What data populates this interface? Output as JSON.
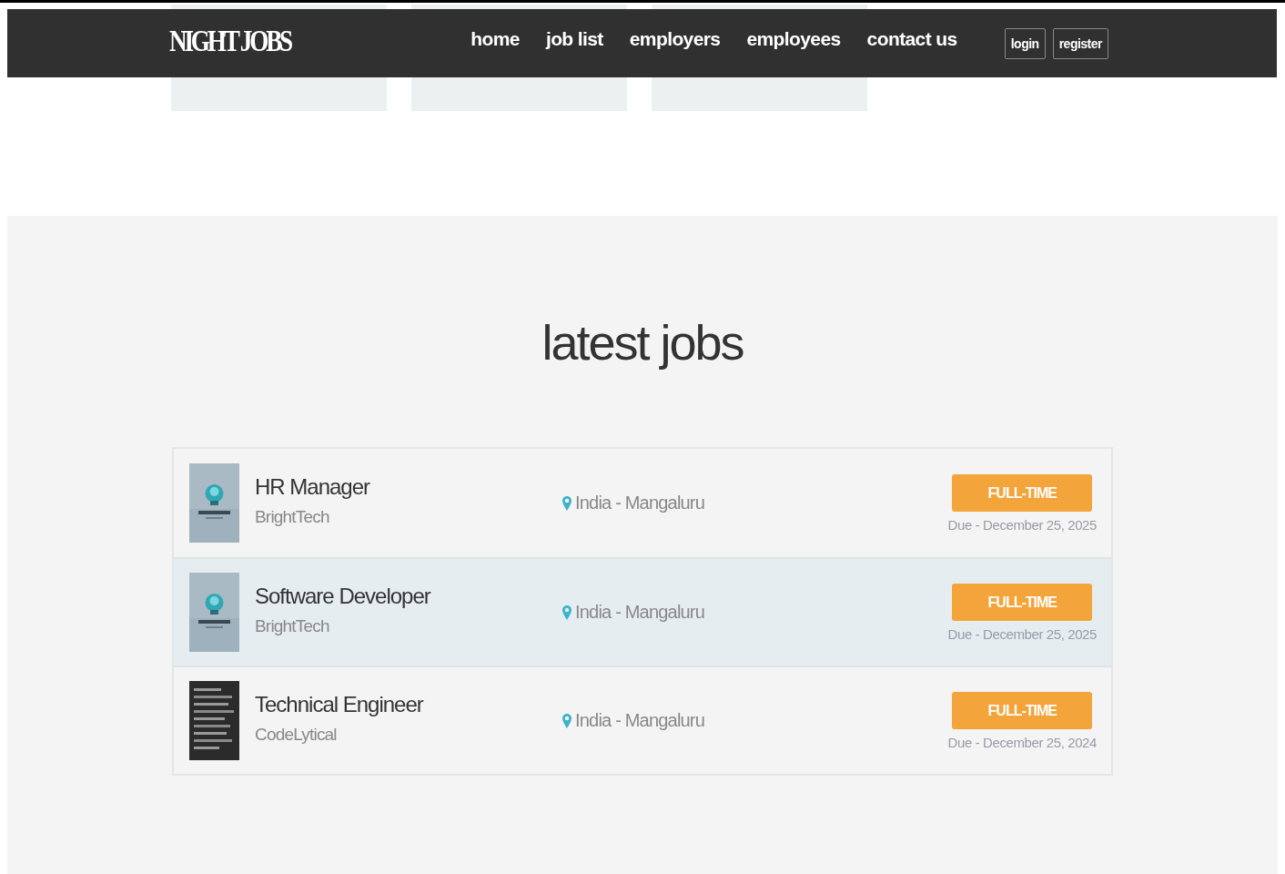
{
  "header": {
    "logo": "NIGHT JOBS",
    "nav": [
      {
        "label": "home"
      },
      {
        "label": "job list"
      },
      {
        "label": "employers"
      },
      {
        "label": "employees"
      },
      {
        "label": "contact us"
      }
    ],
    "buttons": [
      "login",
      "register"
    ]
  },
  "latest_jobs": {
    "title": "latest jobs",
    "jobs": [
      {
        "title": "HR Manager",
        "company": "BrightTech",
        "location": "India - Mangaluru",
        "type": "FULL-TIME",
        "due": "Due - December 25, 2025",
        "selected": false
      },
      {
        "title": "Software Developer",
        "company": "BrightTech",
        "location": "India - Mangaluru",
        "type": "FULL-TIME",
        "due": "Due - December 25, 2025",
        "selected": true
      },
      {
        "title": "Technical Engineer",
        "company": "CodeLytical",
        "location": "India - Mangaluru",
        "type": "FULL-TIME",
        "due": "Due - December 25, 2024",
        "selected": false
      }
    ]
  }
}
